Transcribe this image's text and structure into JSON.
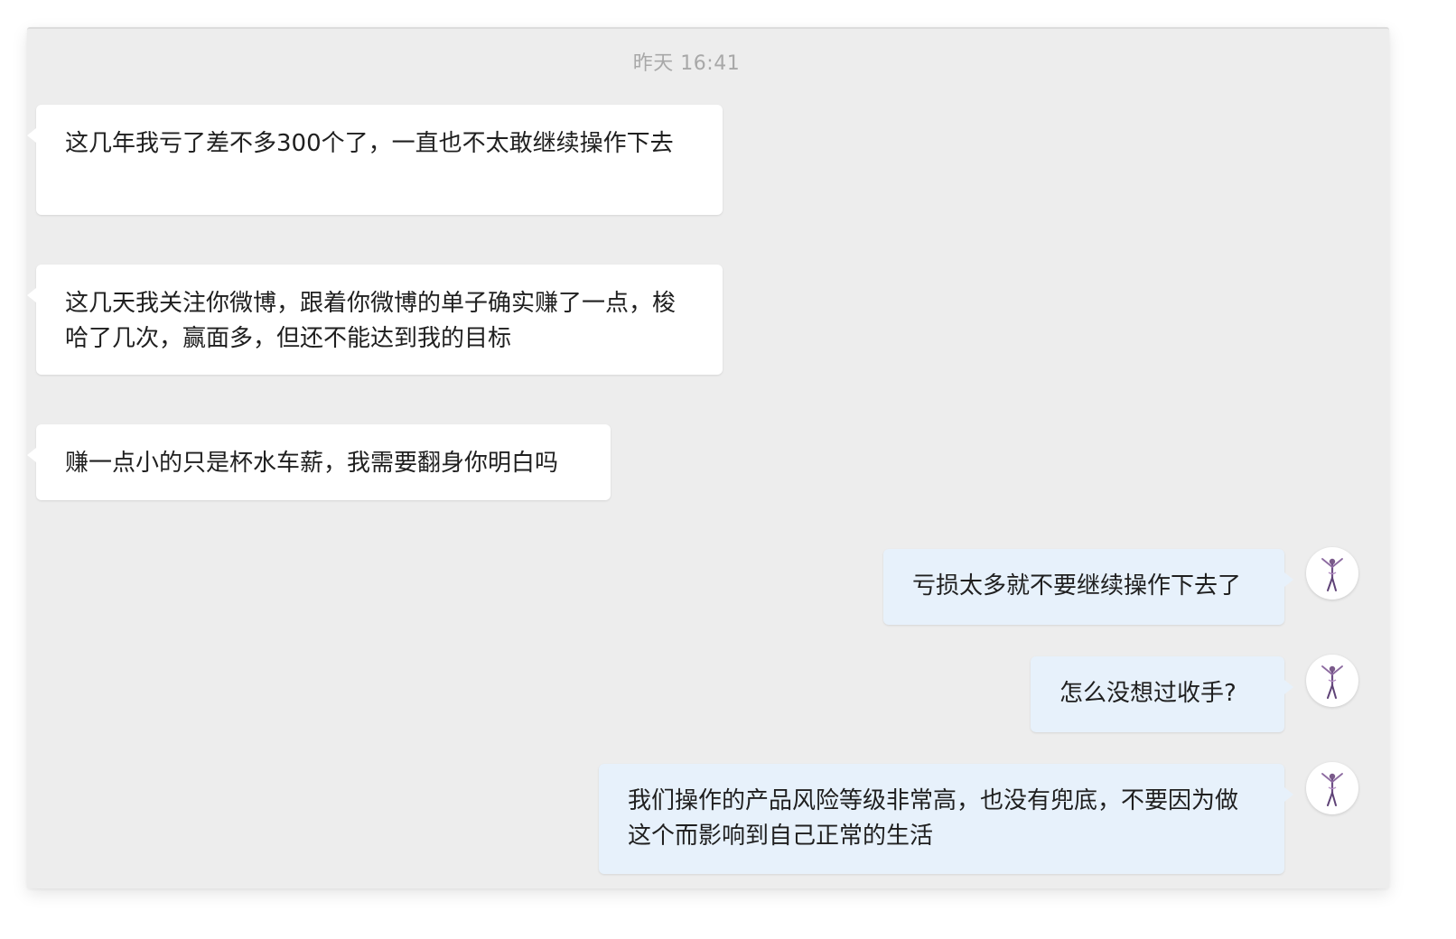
{
  "chat": {
    "timestamp": "昨天 16:41",
    "messages": [
      {
        "side": "received",
        "text": "这几年我亏了差不多300个了，一直也不太敢继续操作下去"
      },
      {
        "side": "received",
        "text": "这几天我关注你微博，跟着你微博的单子确实赚了一点，梭哈了几次，赢面多，但还不能达到我的目标"
      },
      {
        "side": "received",
        "text": "赚一点小的只是杯水车薪，我需要翻身你明白吗"
      },
      {
        "side": "sent",
        "text": "亏损太多就不要继续操作下去了",
        "avatar": "dancer-avatar-icon"
      },
      {
        "side": "sent",
        "text": "怎么没想过收手?",
        "avatar": "dancer-avatar-icon"
      },
      {
        "side": "sent",
        "text": "我们操作的产品风险等级非常高，也没有兜底，不要因为做这个而影响到自己正常的生活",
        "avatar": "dancer-avatar-icon"
      }
    ]
  },
  "colors": {
    "background": "#ededed",
    "received_bubble": "#ffffff",
    "sent_bubble": "#e7f1fb",
    "timestamp_text": "#a8a8a8",
    "message_text": "#1f1f1f"
  }
}
